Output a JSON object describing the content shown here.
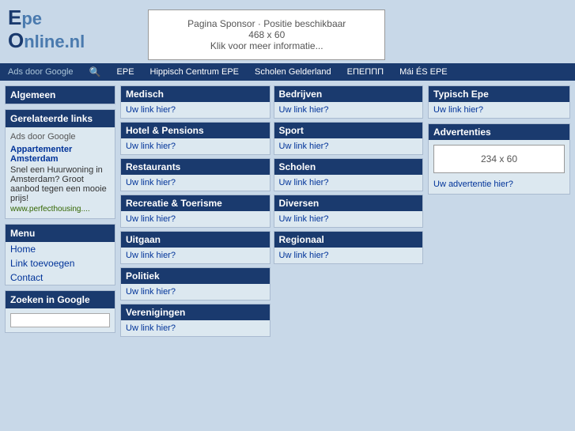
{
  "logo": {
    "line1": "Epe",
    "line2": "Online.nl"
  },
  "sponsor": {
    "line1": "Pagina Sponsor · Positie beschikbaar",
    "line2": "468 x 60",
    "line3": "Klik voor meer informatie..."
  },
  "navbar": {
    "ads_label": "Ads door Google",
    "links": [
      {
        "label": "EPE",
        "url": "#"
      },
      {
        "label": "Hippisch Centrum EPE",
        "url": "#"
      },
      {
        "label": "Scholen Gelderland",
        "url": "#"
      },
      {
        "label": "ΕΠΕΠΠΠ",
        "url": "#"
      },
      {
        "label": "Mái ÉS EPE",
        "url": "#"
      }
    ]
  },
  "sidebar": {
    "algemeen_title": "Algemeen",
    "gerelateerde_title": "Gerelateerde links",
    "ads_google": "Ads door Google",
    "ad_title": "Appartementer Amsterdam",
    "ad_text": "Snel een Huurwoning in Amsterdam? Groot aanbod tegen een mooie prijs!",
    "ad_link_text": "www.perfecthousing....",
    "menu_title": "Menu",
    "menu_items": [
      {
        "label": "Home"
      },
      {
        "label": "Link toevoegen"
      },
      {
        "label": "Contact"
      }
    ],
    "zoeken_title": "Zoeken in Google"
  },
  "categories": [
    {
      "row": [
        {
          "title": "Medisch",
          "link": "Uw link hier?"
        },
        {
          "title": "Bedrijven",
          "link": "Uw link hier?"
        }
      ]
    },
    {
      "row": [
        {
          "title": "Hotel & Pensions",
          "link": "Uw link hier?"
        },
        {
          "title": "Sport",
          "link": "Uw link hier?"
        }
      ]
    },
    {
      "row": [
        {
          "title": "Restaurants",
          "link": "Uw link hier?"
        },
        {
          "title": "Scholen",
          "link": "Uw link hier?"
        }
      ]
    },
    {
      "row": [
        {
          "title": "Recreatie & Toerisme",
          "link": "Uw link hier?"
        },
        {
          "title": "Diversen",
          "link": "Uw link hier?"
        }
      ]
    },
    {
      "row": [
        {
          "title": "Uitgaan",
          "link": "Uw link hier?"
        },
        {
          "title": "Regionaal",
          "link": "Uw link hier?"
        }
      ]
    },
    {
      "row": [
        {
          "title": "Politiek",
          "link": "Uw link hier?"
        }
      ]
    },
    {
      "row": [
        {
          "title": "Verenigingen",
          "link": "Uw link hier?"
        }
      ]
    }
  ],
  "right_col": {
    "typisch_title": "Typisch Epe",
    "typisch_link": "Uw link hier?",
    "advertenties_title": "Advertenties",
    "ad_size": "234 x 60",
    "ad_link": "Uw advertentie hier?"
  }
}
